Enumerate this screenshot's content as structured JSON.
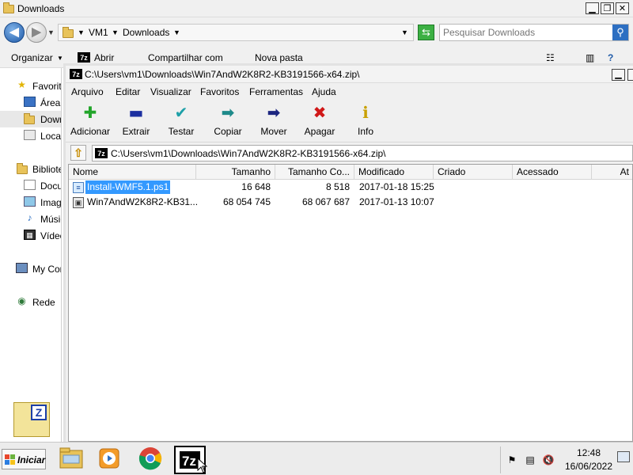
{
  "explorer": {
    "title": "Downloads",
    "breadcrumbs": [
      "VM1",
      "Downloads"
    ],
    "search_placeholder": "Pesquisar Downloads",
    "commands": [
      "Organizar",
      "Abrir",
      "Compartilhar com",
      "Nova pasta"
    ],
    "nav": [
      {
        "label": "Favoritos",
        "icon": "star-icon"
      },
      {
        "label": "Área de Trabalho",
        "icon": "desktop-icon"
      },
      {
        "label": "Downloads",
        "icon": "folder-icon",
        "selected": true
      },
      {
        "label": "Locais",
        "icon": "places-icon"
      },
      {
        "label": "Bibliotecas",
        "icon": "library-icon"
      },
      {
        "label": "Documentos",
        "icon": "document-icon"
      },
      {
        "label": "Imagens",
        "icon": "image-icon"
      },
      {
        "label": "Músicas",
        "icon": "music-icon"
      },
      {
        "label": "Vídeos",
        "icon": "video-icon"
      },
      {
        "label": "My Computer",
        "icon": "computer-icon"
      },
      {
        "label": "Rede",
        "icon": "network-icon"
      }
    ]
  },
  "sevenzip": {
    "app_icon_text": "7z",
    "title": "C:\\Users\\vm1\\Downloads\\Win7AndW2K8R2-KB3191566-x64.zip\\",
    "menus": [
      "Arquivo",
      "Editar",
      "Visualizar",
      "Favoritos",
      "Ferramentas",
      "Ajuda"
    ],
    "toolbar": [
      {
        "label": "Adicionar",
        "icon": "add-icon",
        "glyph": "✚",
        "color": "#22a52a"
      },
      {
        "label": "Extrair",
        "icon": "extract-icon",
        "glyph": "▬",
        "color": "#1c2fa0"
      },
      {
        "label": "Testar",
        "icon": "test-icon",
        "glyph": "✔",
        "color": "#1ea0a8"
      },
      {
        "label": "Copiar",
        "icon": "copy-icon",
        "glyph": "➡",
        "color": "#1e8a8a"
      },
      {
        "label": "Mover",
        "icon": "move-icon",
        "glyph": "➡",
        "color": "#1c2680"
      },
      {
        "label": "Apagar",
        "icon": "delete-icon",
        "glyph": "✖",
        "color": "#d01818"
      },
      {
        "label": "Info",
        "icon": "info-icon",
        "glyph": "ℹ",
        "color": "#c8a000"
      }
    ],
    "path": "C:\\Users\\vm1\\Downloads\\Win7AndW2K8R2-KB3191566-x64.zip\\",
    "columns": [
      "Nome",
      "Tamanho",
      "Tamanho Co...",
      "Modificado",
      "Criado",
      "Acessado",
      "At"
    ],
    "files": [
      {
        "name": "Install-WMF5.1.ps1",
        "size": "16 648",
        "packed": "8 518",
        "modified": "2017-01-18 15:25",
        "created": "",
        "accessed": "",
        "selected": true,
        "icon": "script-file-icon"
      },
      {
        "name": "Win7AndW2K8R2-KB31...",
        "size": "68 054 745",
        "packed": "68 067 687",
        "modified": "2017-01-13 10:07",
        "created": "",
        "accessed": "",
        "selected": false,
        "icon": "package-file-icon"
      }
    ]
  },
  "taskbar": {
    "start_label": "Iniciar",
    "apps": [
      {
        "name": "explorer-taskbar-button",
        "icon": "folder-icon"
      },
      {
        "name": "media-player-taskbar-button",
        "icon": "media-player-icon"
      },
      {
        "name": "chrome-taskbar-button",
        "icon": "chrome-icon"
      },
      {
        "name": "sevenzip-taskbar-button",
        "icon": "sevenzip-icon",
        "active": true
      }
    ],
    "time": "12:48",
    "date": "16/06/2022"
  }
}
